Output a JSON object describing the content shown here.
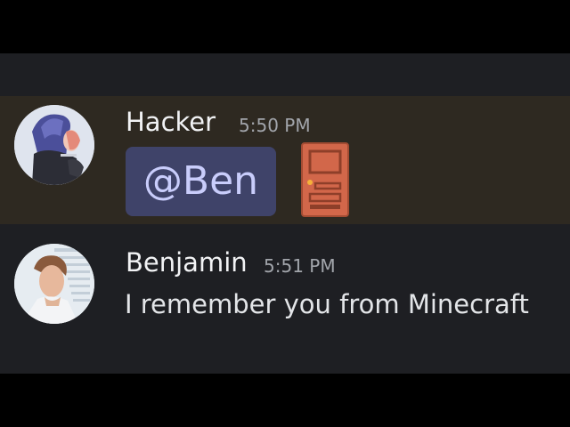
{
  "messages": [
    {
      "author": "Hacker",
      "timestamp": "5:50 PM",
      "mention": "@Ben",
      "emoji": "door-emoji",
      "highlighted": true,
      "highlight_color": "#2e2921"
    },
    {
      "author": "Benjamin",
      "timestamp": "5:51 PM",
      "text": "I remember you from Minecraft"
    }
  ],
  "colors": {
    "background": "#1e1f23",
    "mention_pill": "#3f4369",
    "mention_text": "#c9cdfb",
    "username": "#f2f3f5",
    "timestamp": "#a2a5ab"
  }
}
